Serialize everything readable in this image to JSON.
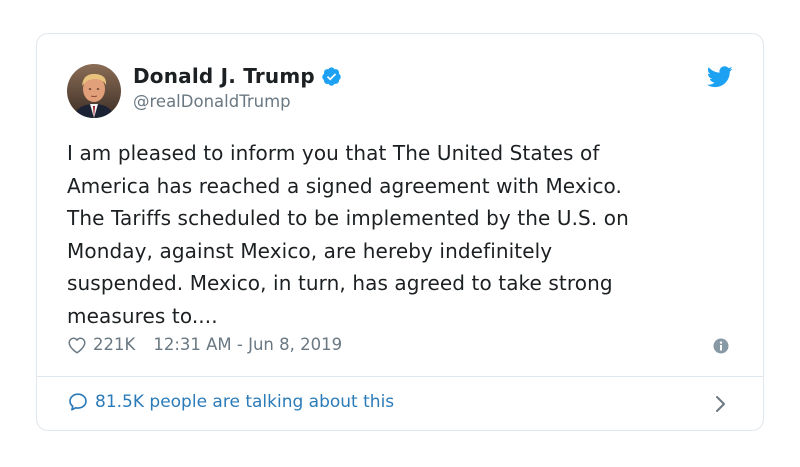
{
  "author": {
    "name": "Donald J. Trump",
    "handle": "@realDonaldTrump"
  },
  "tweet": {
    "lines": [
      "I am pleased to inform you that The United States of",
      "America has reached a signed agreement with Mexico.",
      "The Tariffs scheduled to be implemented by the U.S. on",
      "Monday, against Mexico, are hereby indefinitely",
      "suspended. Mexico, in turn, has agreed to take strong",
      "measures to...."
    ]
  },
  "meta": {
    "likes": "221K",
    "timestamp": "12:31 AM - Jun 8, 2019"
  },
  "footer": {
    "talking": "81.5K people are talking about this"
  },
  "icons": {
    "verified": "verified-badge-icon",
    "twitter": "twitter-bird-icon",
    "like": "heart-icon",
    "info": "info-icon",
    "reply": "speech-bubble-icon",
    "chevron": "chevron-right-icon"
  },
  "colors": {
    "twitter_blue": "#1da1f2",
    "link_blue": "#2b7bb9",
    "muted_gray": "#697882",
    "text": "#1c2022"
  }
}
